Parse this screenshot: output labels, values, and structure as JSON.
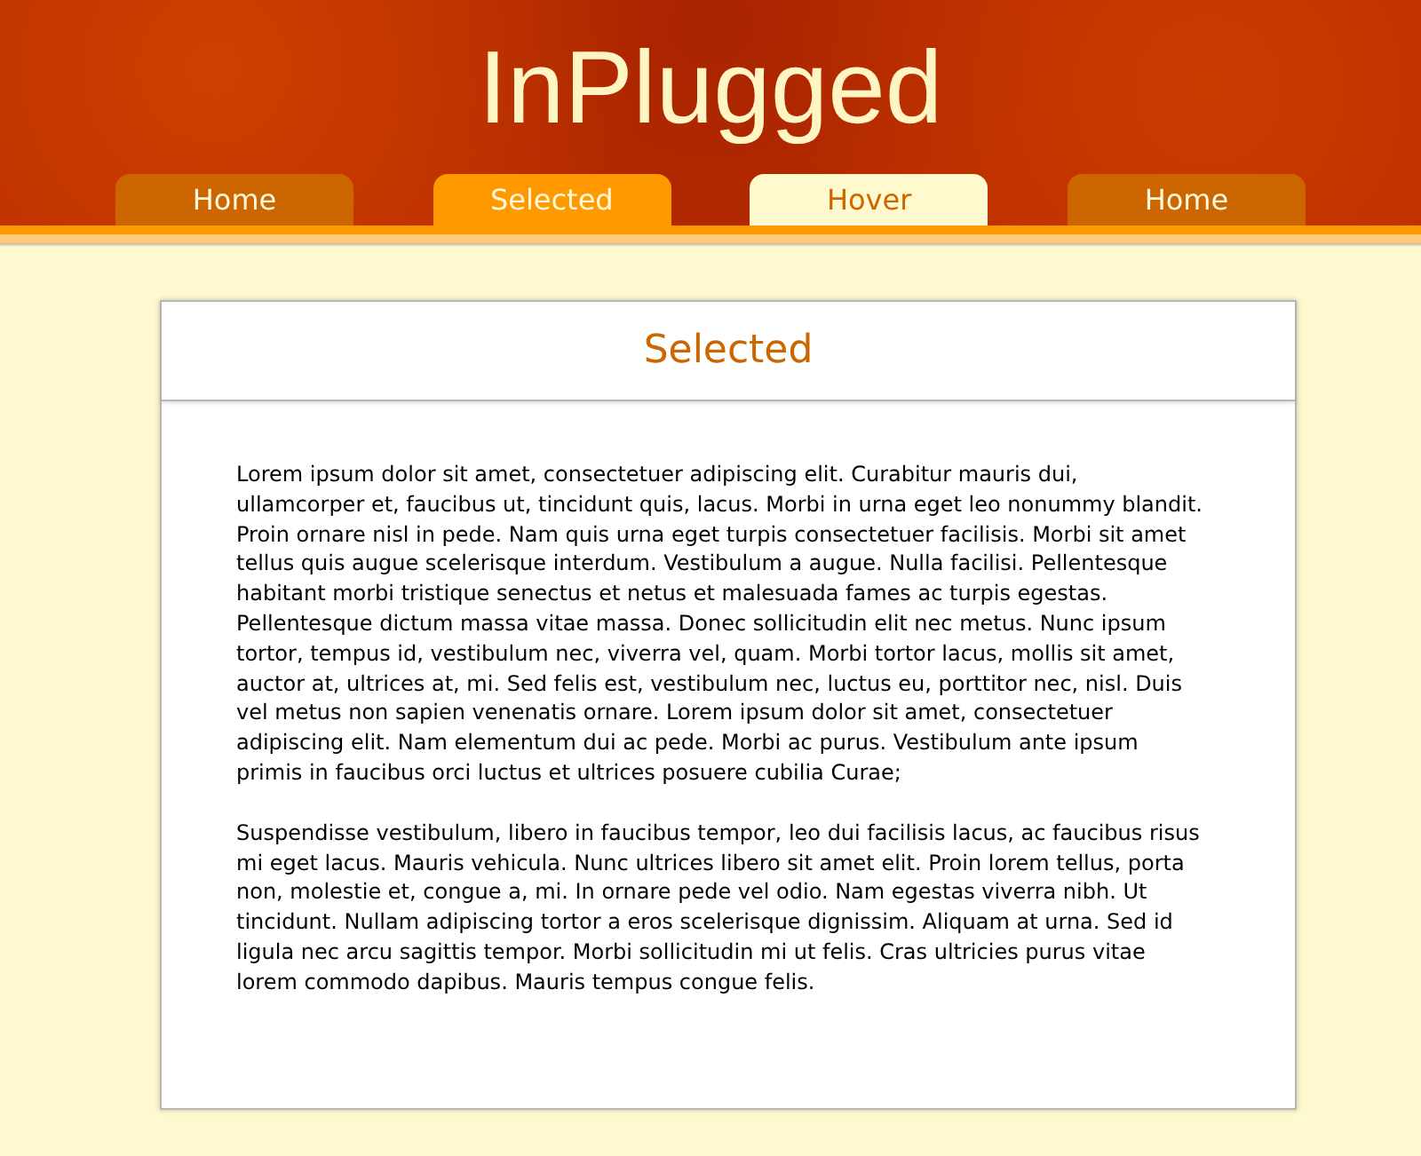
{
  "site": {
    "title": "InPlugged"
  },
  "nav_tabs": [
    {
      "label": "Home",
      "selected": false,
      "hovered": false
    },
    {
      "label": "Selected",
      "selected": true,
      "hovered": false
    },
    {
      "label": "Hover",
      "selected": false,
      "hovered": true
    },
    {
      "label": "Home",
      "selected": false,
      "hovered": false
    }
  ],
  "content": {
    "heading": "Selected",
    "paragraphs": [
      "Lorem ipsum dolor sit amet, consectetuer adipiscing elit. Curabitur mauris dui, ullamcorper et, faucibus ut, tincidunt quis, lacus. Morbi in urna eget leo nonummy blandit. Proin ornare nisl in pede. Nam quis urna eget turpis consectetuer facilisis. Morbi sit amet tellus quis augue scelerisque interdum. Vestibulum a augue. Nulla facilisi. Pellentesque habitant morbi tristique senectus et netus et malesuada fames ac turpis egestas. Pellentesque dictum massa vitae massa. Donec sollicitudin elit nec metus. Nunc ipsum tortor, tempus id, vestibulum nec, viverra vel, quam. Morbi tortor lacus, mollis sit amet, auctor at, ultrices at, mi. Sed felis est, vestibulum nec, luctus eu, porttitor nec, nisl. Duis vel metus non sapien venenatis ornare. Lorem ipsum dolor sit amet, consectetuer adipiscing elit. Nam elementum dui ac pede. Morbi ac purus. Vestibulum ante ipsum primis in faucibus orci luctus et ultrices posuere cubilia Curae;",
      "Suspendisse vestibulum, libero in faucibus tempor, leo dui facilisis lacus, ac faucibus risus mi eget lacus. Mauris vehicula. Nunc ultrices libero sit amet elit. Proin lorem tellus, porta non, molestie et, congue a, mi. In ornare pede vel odio. Nam egestas viverra nibh. Ut tincidunt. Nullam adipiscing tortor a eros scelerisque dignissim. Aliquam at urna. Sed id ligula nec arcu sagittis tempor. Morbi sollicitudin mi ut felis. Cras ultricies purus vitae lorem commodo dapibus. Mauris tempus congue felis."
    ]
  }
}
